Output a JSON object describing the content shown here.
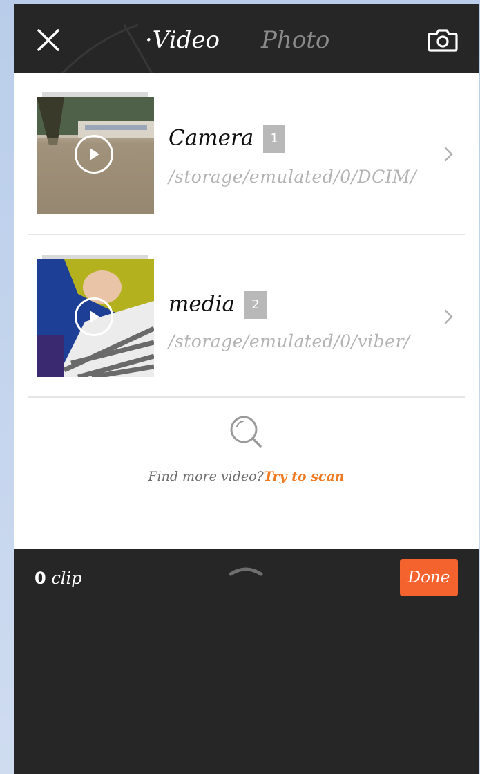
{
  "header": {
    "close_icon": "close-icon",
    "tabs": [
      {
        "label": "·Video",
        "active": true
      },
      {
        "label": "Photo",
        "active": false
      }
    ],
    "camera_icon": "camera-icon"
  },
  "folders": [
    {
      "name": "Camera",
      "count": "1",
      "path": "/storage/emulated/0/DCIM/",
      "icon": "play-icon"
    },
    {
      "name": "media",
      "count": "2",
      "path": "/storage/emulated/0/viber/",
      "icon": "play-icon"
    }
  ],
  "scan": {
    "icon": "search-icon",
    "prompt": "Find more video?",
    "link": "Try to scan"
  },
  "bottom": {
    "clip_count": "0",
    "clip_label": "clip",
    "done_label": "Done"
  },
  "colors": {
    "bar_dark": "#262626",
    "accent_orange": "#f4622e",
    "link_orange": "#f07a21"
  }
}
